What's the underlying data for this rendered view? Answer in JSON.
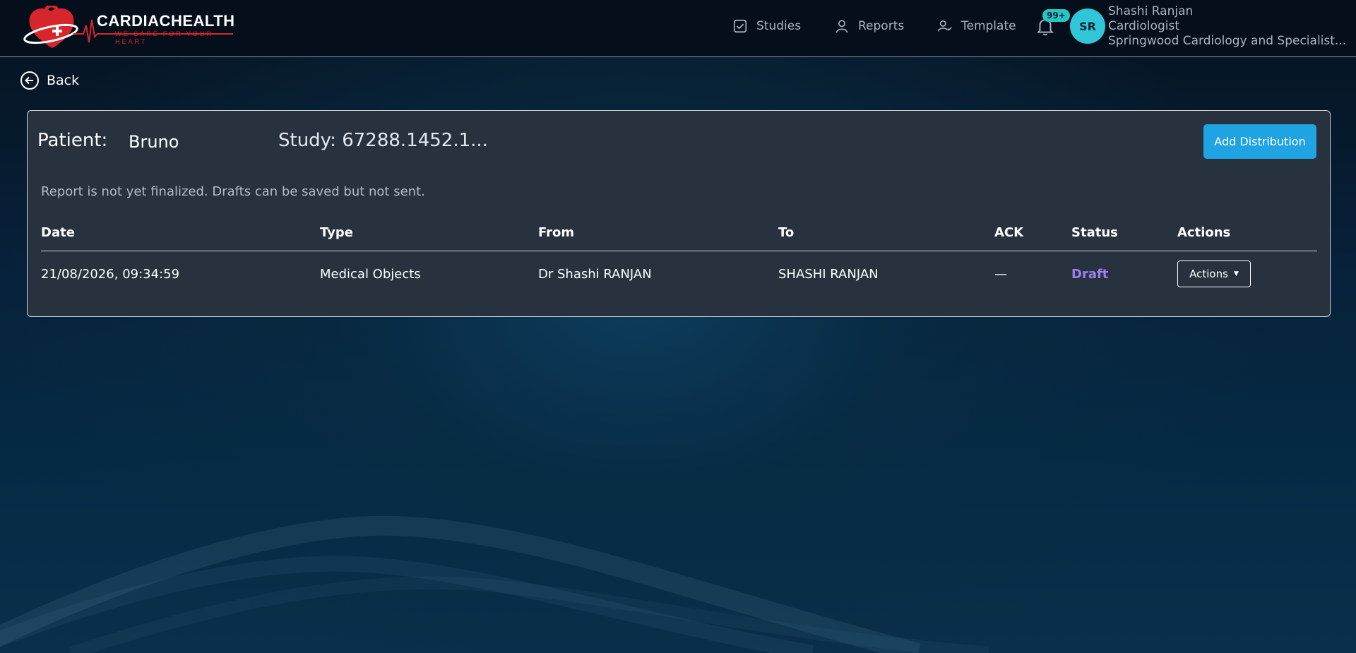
{
  "app": {
    "brand_name": "CARDIACHEALTH",
    "brand_tagline": "WE CARE FOR YOUR HEART"
  },
  "nav": {
    "items": [
      {
        "label": "Studies",
        "icon": "checkbox-icon"
      },
      {
        "label": "Reports",
        "icon": "user-icon"
      },
      {
        "label": "Template",
        "icon": "user-check-icon"
      }
    ],
    "notifications_badge": "99+"
  },
  "user": {
    "initials": "SR",
    "name": "Shashi Ranjan",
    "role": "Cardiologist",
    "organization": "Springwood Cardiology and Specialist..."
  },
  "back_label": "Back",
  "card": {
    "patient_label": "Patient:",
    "patient_name": "Bruno",
    "study_label": "Study: 67288.1452.1...",
    "add_button_label": "Add Distribution",
    "notice": "Report is not yet finalized. Drafts can be saved but not sent."
  },
  "table": {
    "headers": [
      "Date",
      "Type",
      "From",
      "To",
      "ACK",
      "Status",
      "Actions"
    ],
    "rows": [
      {
        "date": "21/08/2026, 09:34:59",
        "type": "Medical Objects",
        "from": "Dr Shashi RANJAN",
        "to": "SHASHI RANJAN",
        "ack": "—",
        "status": "Draft",
        "actions_label": "Actions"
      }
    ]
  },
  "colors": {
    "accent": "#1fa3e2",
    "badge": "#25c6c4",
    "avatar": "#2fc6d8",
    "draft_status": "#9d7df2",
    "brand_red": "#d7262b"
  }
}
